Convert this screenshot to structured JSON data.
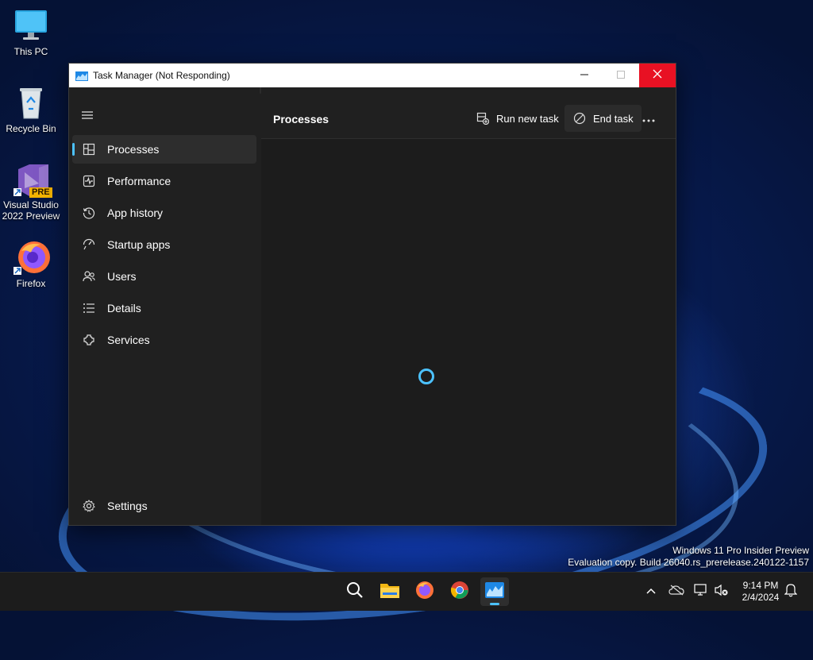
{
  "desktop": {
    "icons": [
      {
        "label": "This PC",
        "icon": "monitor-icon"
      },
      {
        "label": "Recycle Bin",
        "icon": "recycle-bin-icon"
      },
      {
        "label_line1": "Visual Studio",
        "label_line2": "2022 Preview",
        "badge": "PRE",
        "icon": "visual-studio-icon"
      },
      {
        "label": "Firefox",
        "icon": "firefox-icon"
      }
    ],
    "watermark": {
      "line1": "Windows 11 Pro Insider Preview",
      "line2": "Evaluation copy. Build 26040.rs_prerelease.240122-1157"
    }
  },
  "window": {
    "title": "Task Manager (Not Responding)",
    "controls": {
      "minimize": "minimize-icon",
      "maximize": "maximize-icon",
      "close": "close-icon"
    }
  },
  "sidebar": {
    "items": [
      {
        "label": "Processes",
        "icon": "processes-icon",
        "active": true
      },
      {
        "label": "Performance",
        "icon": "performance-icon"
      },
      {
        "label": "App history",
        "icon": "app-history-icon"
      },
      {
        "label": "Startup apps",
        "icon": "startup-apps-icon"
      },
      {
        "label": "Users",
        "icon": "users-icon"
      },
      {
        "label": "Details",
        "icon": "details-icon"
      },
      {
        "label": "Services",
        "icon": "services-icon"
      }
    ],
    "settings_label": "Settings"
  },
  "main": {
    "page_title": "Processes",
    "run_new_task_label": "Run new task",
    "end_task_label": "End task",
    "more_icon": "more-icon",
    "status": "loading"
  },
  "taskbar": {
    "items": [
      "search-icon",
      "file-explorer-icon",
      "firefox-icon",
      "chrome-icon",
      "task-manager-icon"
    ],
    "active_item": "task-manager-icon",
    "tray": [
      "chevron-up-icon",
      "onedrive-icon",
      "network-icon",
      "volume-muted-icon",
      "notification-icon"
    ],
    "time": "9:14 PM",
    "date": "2/4/2024"
  },
  "colors": {
    "accent": "#4cc2ff",
    "close_button": "#e81123",
    "window_bg": "#202020",
    "content_bg": "#1c1c1c"
  }
}
